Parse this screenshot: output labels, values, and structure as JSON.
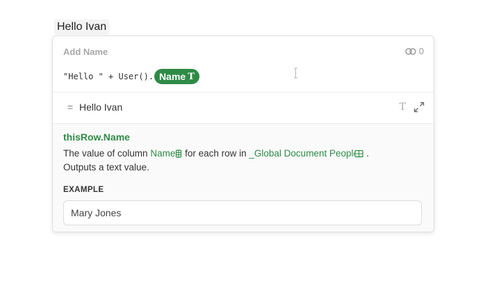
{
  "canvas": {
    "text": "Hello Ivan"
  },
  "formula_panel": {
    "title": "Add Name",
    "reference_count": "0",
    "formula": {
      "prefix": "\"Hello \" + User().",
      "chip_label": "Name",
      "chip_type_icon": "T"
    },
    "result": {
      "equals": "=",
      "value": "Hello Ivan",
      "type_icon": "T"
    }
  },
  "help": {
    "title": "thisRow.Name",
    "desc_part1": "The value of column ",
    "column_name": "Name",
    "desc_part2": " for each row in ",
    "table_name": "_Global Document People",
    "desc_part3": " .",
    "desc_line2": "Outputs a text value.",
    "example_label": "EXAMPLE",
    "example_value": "Mary Jones"
  },
  "colors": {
    "accent_green": "#2e8b46",
    "muted_gray": "#a8a8a8"
  },
  "icons": {
    "reference": "link-icon",
    "result_type": "text-type-icon",
    "expand": "expand-icon",
    "column": "column-icon",
    "table": "table-icon"
  }
}
